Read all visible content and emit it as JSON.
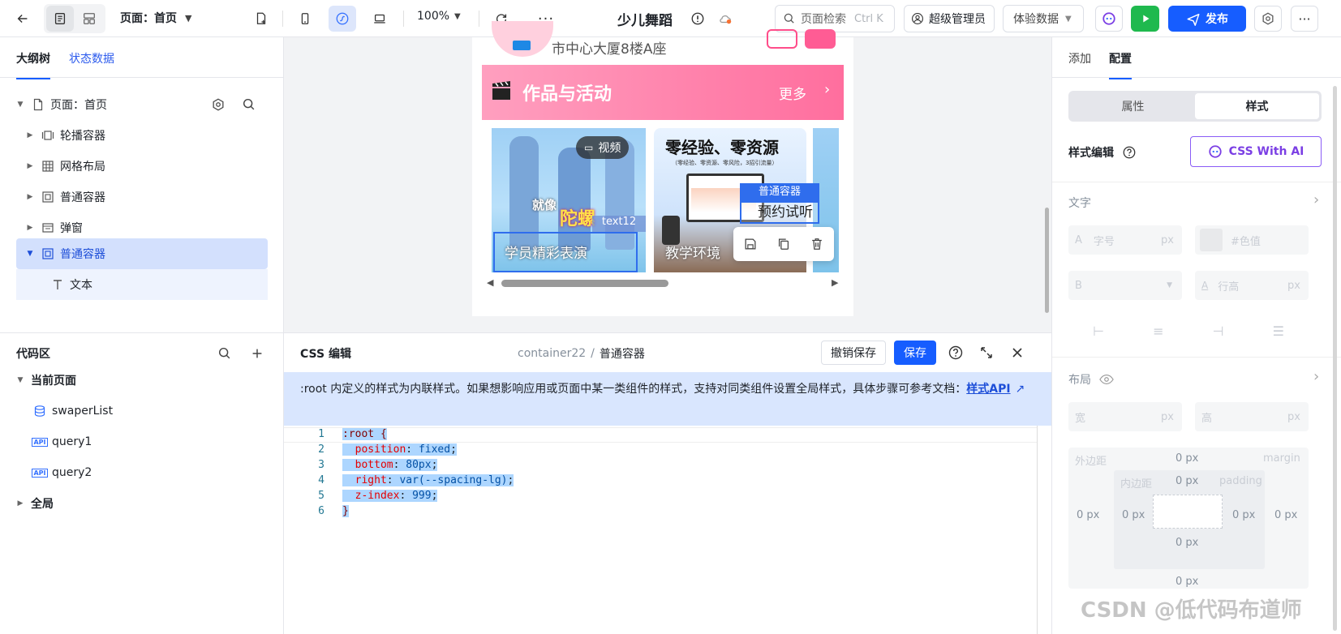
{
  "topbar": {
    "page_label": "页面：首页",
    "zoom": "100%",
    "app_title": "少儿舞蹈",
    "search_placeholder": "页面检索",
    "search_shortcut": "Ctrl K",
    "user_role": "超级管理员",
    "data_mode": "体验数据",
    "publish": "发布"
  },
  "left": {
    "tabs": [
      "大纲树",
      "状态数据"
    ],
    "tree": [
      {
        "label": "页面：首页",
        "icon": "file-icon"
      },
      {
        "label": "轮播容器",
        "icon": "carousel-icon"
      },
      {
        "label": "网格布局",
        "icon": "grid-icon"
      },
      {
        "label": "普通容器",
        "icon": "container-icon"
      },
      {
        "label": "弹窗",
        "icon": "dialog-icon"
      },
      {
        "label": "普通容器",
        "icon": "container-icon"
      },
      {
        "label": "文本",
        "icon": "text-icon"
      }
    ],
    "code_area_title": "代码区",
    "current_page": "当前页面",
    "code_items": [
      {
        "label": "swaperList",
        "icon": "database-icon"
      },
      {
        "label": "query1",
        "icon": "api-icon",
        "badge": "API"
      },
      {
        "label": "query2",
        "icon": "api-icon",
        "badge": "API"
      }
    ],
    "global": "全局"
  },
  "preview": {
    "address": "市中心大厦8楼A座",
    "banner_title": "作品与活动",
    "banner_more": "更多",
    "card1_badge": "视频",
    "card1_caption": "学员精彩表演",
    "card1_text_tag": "text12",
    "card1_overlay_a": "就像",
    "card1_overlay_b": "陀螺",
    "card2_headline": "零经验、零资源",
    "card2_sub": "（零经验、零资源、零风险，3招引流量）",
    "card2_caption": "教学环境",
    "selected_tag": "普通容器",
    "selected_text": "预约试听"
  },
  "css_editor": {
    "title": "CSS 编辑",
    "breadcrumb_parent": "container22",
    "breadcrumb_sep": "/",
    "breadcrumb_current": "普通容器",
    "cancel_save": "撤销保存",
    "save": "保存",
    "notice": ":root 内定义的样式为内联样式。如果想影响应用或页面中某一类组件的样式，支持对同类组件设置全局样式，具体步骤可参考文档：",
    "notice_link": "样式API",
    "code_lines": [
      {
        "num": "1",
        "parts": [
          {
            "t": ":root {",
            "c": "sel"
          }
        ]
      },
      {
        "num": "2",
        "parts": [
          {
            "t": "  position",
            "c": "prop"
          },
          {
            "t": ": ",
            "c": ""
          },
          {
            "t": "fixed",
            "c": "val"
          },
          {
            "t": ";",
            "c": ""
          }
        ]
      },
      {
        "num": "3",
        "parts": [
          {
            "t": "  bottom",
            "c": "prop"
          },
          {
            "t": ": ",
            "c": ""
          },
          {
            "t": "80px",
            "c": "val"
          },
          {
            "t": ";",
            "c": ""
          }
        ]
      },
      {
        "num": "4",
        "parts": [
          {
            "t": "  right",
            "c": "prop"
          },
          {
            "t": ": ",
            "c": ""
          },
          {
            "t": "var(--spacing-lg)",
            "c": "val"
          },
          {
            "t": ";",
            "c": ""
          }
        ]
      },
      {
        "num": "5",
        "parts": [
          {
            "t": "  z-index",
            "c": "prop"
          },
          {
            "t": ": ",
            "c": ""
          },
          {
            "t": "999",
            "c": "val"
          },
          {
            "t": ";",
            "c": ""
          }
        ]
      },
      {
        "num": "6",
        "parts": [
          {
            "t": "}",
            "c": "sel"
          }
        ]
      }
    ]
  },
  "right": {
    "tabs": [
      "添加",
      "配置"
    ],
    "segment": [
      "属性",
      "样式"
    ],
    "style_edit": "样式编辑",
    "css_ai": "CSS With AI",
    "text_section": "文字",
    "font_size_prefix": "A",
    "font_size_placeholder": "字号",
    "unit_px": "px",
    "color_placeholder": "#色值",
    "bold_prefix": "B",
    "line_height_placeholder": "行高",
    "layout_section": "布局",
    "width_label": "宽",
    "height_label": "高",
    "margin_label": "外边距",
    "margin_en": "margin",
    "padding_label": "内边距",
    "padding_en": "padding",
    "zero_px": "0 px"
  },
  "watermark": "CSDN @低代码布道师"
}
